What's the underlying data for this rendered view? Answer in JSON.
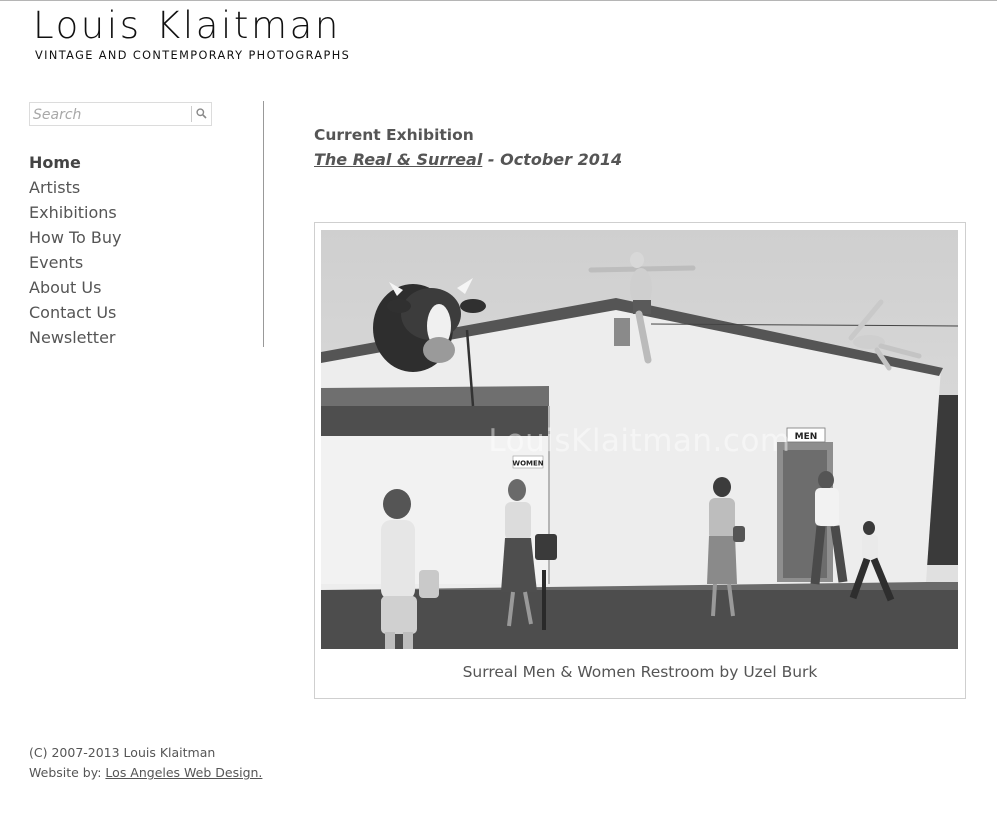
{
  "header": {
    "title": "Louis Klaitman",
    "tagline": "VINTAGE AND CONTEMPORARY PHOTOGRAPHS"
  },
  "search": {
    "placeholder": "Search",
    "value": "",
    "button_icon": "search-icon"
  },
  "nav": {
    "items": [
      {
        "label": "Home",
        "active": true
      },
      {
        "label": "Artists",
        "active": false
      },
      {
        "label": "Exhibitions",
        "active": false
      },
      {
        "label": "How To Buy",
        "active": false
      },
      {
        "label": "Events",
        "active": false
      },
      {
        "label": "About Us",
        "active": false
      },
      {
        "label": "Contact Us",
        "active": false
      },
      {
        "label": "Newsletter",
        "active": false
      }
    ]
  },
  "exhibition": {
    "heading": "Current Exhibition",
    "title_link": "The Real & Surreal",
    "date_suffix": " - October 2014"
  },
  "featured_photo": {
    "watermark": "LouisKlaitman.com",
    "sign_men": "MEN",
    "sign_women": "WOMEN",
    "caption": "Surreal Men & Women Restroom by Uzel Burk"
  },
  "footer": {
    "copyright": "(C) 2007-2013 Louis Klaitman",
    "credit_prefix": "Website by: ",
    "credit_link": "Los Angeles Web Design."
  },
  "colors": {
    "text": "#555555",
    "title": "#111111",
    "rule": "#999999",
    "frame_border": "#cfcfcf"
  }
}
